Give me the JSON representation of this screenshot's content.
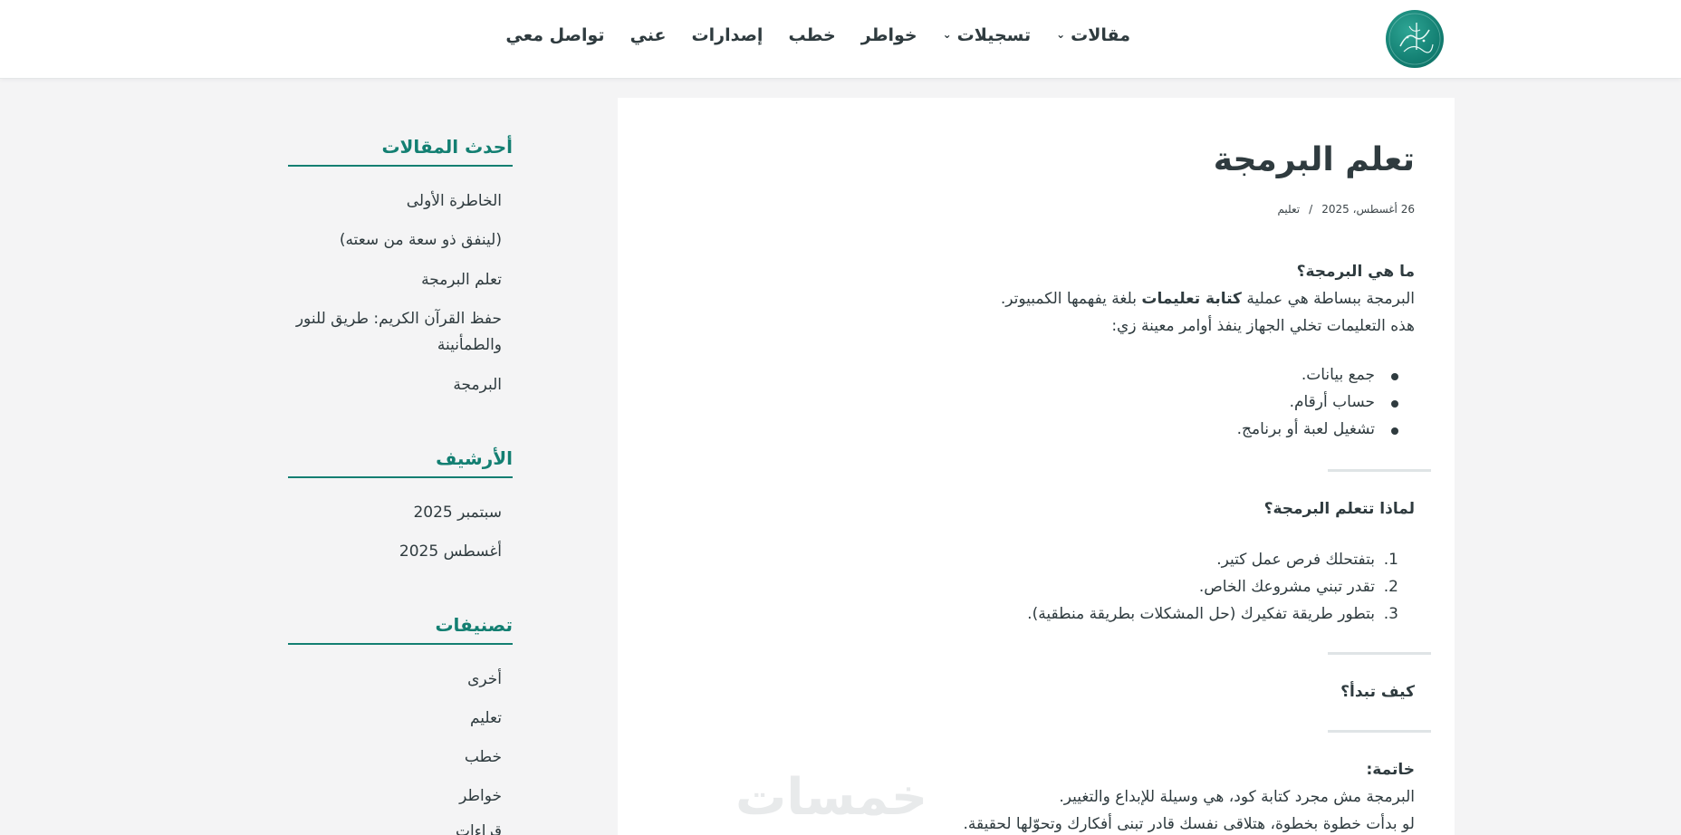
{
  "header": {
    "logo": "site-logo-calligraphy",
    "nav": [
      {
        "label": "مقالات",
        "dropdown": true
      },
      {
        "label": "تسجيلات",
        "dropdown": true
      },
      {
        "label": "خواطر",
        "dropdown": false
      },
      {
        "label": "خطب",
        "dropdown": false
      },
      {
        "label": "إصدارات",
        "dropdown": false
      },
      {
        "label": "عني",
        "dropdown": false
      },
      {
        "label": "تواصل معي",
        "dropdown": false
      }
    ]
  },
  "article": {
    "title": "تعلم البرمجة",
    "date": "26 أغسطس، 2025",
    "separator": "/",
    "category": "تعليم",
    "section1": {
      "heading": "ما هي البرمجة؟",
      "p1_before": "البرمجة ببساطة هي عملية ",
      "p1_bold": "كتابة تعليمات",
      "p1_after": " بلغة يفهمها الكمبيوتر.",
      "p2": "هذه التعليمات تخلي الجهاز ينفذ أوامر معينة زي:",
      "bullets": [
        "جمع بيانات.",
        "حساب أرقام.",
        "تشغيل لعبة أو برنامج."
      ]
    },
    "section2": {
      "heading": "لماذا تتعلم البرمجة؟",
      "items": [
        {
          "num": "1.",
          "text": "بتفتحلك فرص عمل كتير."
        },
        {
          "num": "2.",
          "text": "تقدر تبني مشروعك الخاص."
        },
        {
          "num": "3.",
          "text": "بتطور طريقة تفكيرك (حل المشكلات بطريقة منطقية)."
        }
      ]
    },
    "section3": {
      "heading": "كيف تبدأ؟"
    },
    "section4": {
      "heading": "خاتمة:",
      "p1": "البرمجة مش مجرد كتابة كود، هي وسيلة للإبداع والتغيير.",
      "p2": "لو بدأت خطوة بخطوة، هتلاقى نفسك قادر تبنى أفكارك وتحوّلها لحقيقة."
    },
    "watermark": "خمسات"
  },
  "sidebar": {
    "latest": {
      "title": "أحدث المقالات",
      "items": [
        "الخاطرة الأولى",
        "(لينفق ذو سعة من سعته)",
        "تعلم البرمجة",
        "حفظ القرآن الكريم: طريق للنور والطمأنينة",
        "البرمجة"
      ]
    },
    "archive": {
      "title": "الأرشيف",
      "items": [
        "سبتمبر 2025",
        "أغسطس 2025"
      ]
    },
    "categories": {
      "title": "تصنيفات",
      "items": [
        "أخرى",
        "تعليم",
        "خطب",
        "خواطر",
        "قراءات"
      ]
    }
  },
  "colors": {
    "accent": "#137f72",
    "text": "#2f3b3f",
    "background": "#f4f4f5"
  }
}
